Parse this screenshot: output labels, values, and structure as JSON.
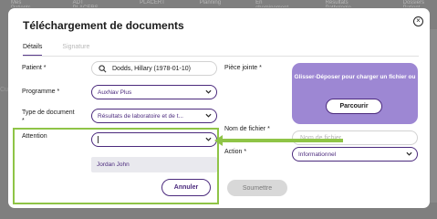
{
  "background": {
    "tabs": [
      "Mes Patients",
      "ADT PLACERS",
      "PLACERT",
      "Planning",
      "En cheminement",
      "Résultats Pathologie",
      "Dossiers Patient"
    ],
    "left_hint": "Cu"
  },
  "modal": {
    "title": "Téléchargement de documents",
    "tabs": [
      {
        "label": "Détails",
        "active": true
      },
      {
        "label": "Signature",
        "active": false
      }
    ],
    "labels": {
      "patient": "Patient *",
      "programme": "Programme *",
      "type_document": "Type de document *",
      "attention": "Attention",
      "piece_jointe": "Pièce jointe *",
      "nom_fichier": "Nom de fichier *",
      "action": "Action *"
    },
    "patient_value": "Dodds, Hillary (1978-01-10)",
    "programme_value": "AuxNav Plus",
    "type_document_value": "Résultats de laboratoire et de t...",
    "attention_value": "",
    "attention_options": [
      "Jordan John"
    ],
    "dropzone_text": "Glisser-Déposer pour charger un fichier ou",
    "browse_label": "Parcourir",
    "filename_placeholder": "Nom de fichier",
    "action_value": "Informationnel",
    "cancel_label": "Annuler",
    "submit_label": "Soumettre"
  },
  "colors": {
    "primary": "#4b2a7d",
    "dropzone": "#9d87d3",
    "highlight": "#8fc447"
  },
  "icons": [
    "close-icon",
    "search-icon",
    "chevron-down-icon"
  ]
}
